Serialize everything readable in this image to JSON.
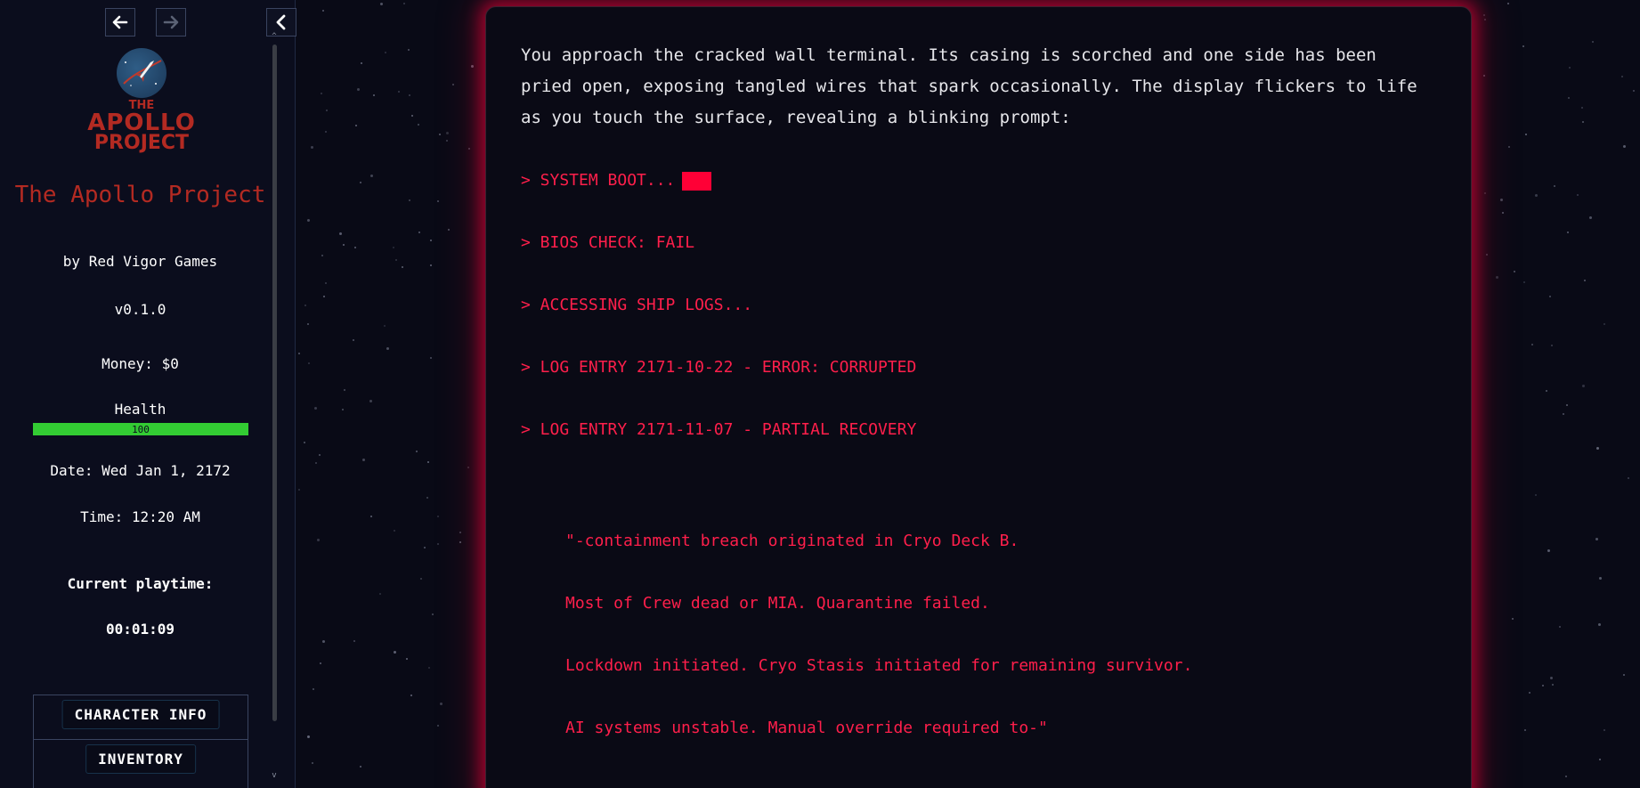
{
  "sidebar": {
    "nav": {
      "back_icon": "arrow-left-icon",
      "forward_icon": "arrow-right-icon",
      "collapse_icon": "chevron-left-icon"
    },
    "logo": {
      "line1": "THE",
      "line2": "APOLLO",
      "line3": "PROJECT"
    },
    "game_title": "The Apollo Project",
    "author": "by Red Vigor Games",
    "version": "v0.1.0",
    "money": "Money: $0",
    "health_label": "Health",
    "health_value": "100",
    "health_percent": 100,
    "date": "Date: Wed Jan 1, 2172",
    "time": "Time: 12:20 AM",
    "playtime_label": "Current playtime:",
    "playtime": "00:01:09",
    "menu": {
      "character_info": "CHARACTER INFO",
      "inventory": "INVENTORY"
    }
  },
  "story": {
    "intro": "You approach the cracked wall terminal. Its casing is scorched and one side has been pried open, exposing tangled wires that spark occasionally. The display flickers to life as you touch the surface, revealing a blinking prompt:",
    "terminal": [
      "> SYSTEM BOOT...",
      "> BIOS CHECK: FAIL",
      "> ACCESSING SHIP LOGS...",
      "> LOG ENTRY 2171-10-22 - ERROR: CORRUPTED",
      "> LOG ENTRY 2171-11-07 - PARTIAL RECOVERY"
    ],
    "log": [
      "\"-containment breach originated in Cryo Deck B.",
      "Most of Crew dead or MIA. Quarantine failed.",
      "Lockdown initiated. Cryo Stasis initiated for remaining survivor.",
      "AI systems unstable. Manual override required to-\""
    ]
  },
  "colors": {
    "terminal_red": "#ff1f4b",
    "title_red": "#b32a22",
    "health_green": "#33cc33",
    "glow": "#ff003c"
  }
}
